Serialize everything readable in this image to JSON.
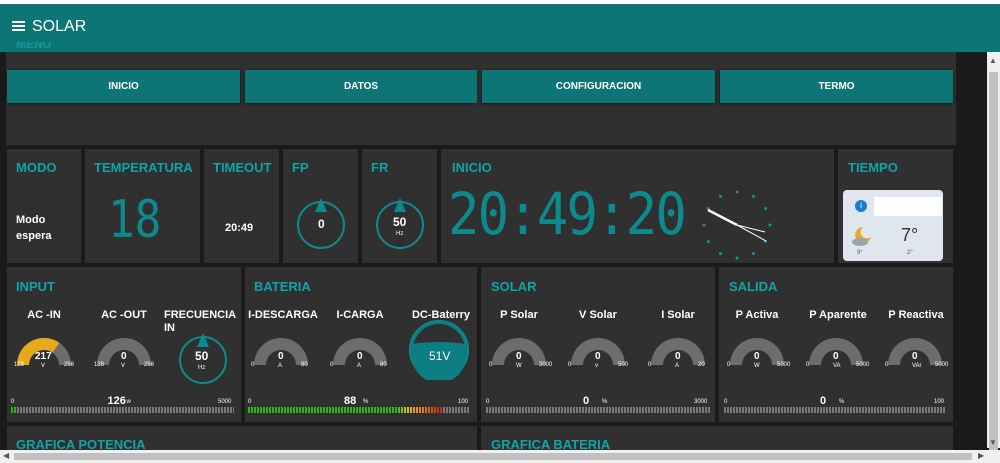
{
  "header": {
    "title": "SOLAR"
  },
  "menu": {
    "group_title": "MENU",
    "buttons": [
      "INICIO",
      "DATOS",
      "CONFIGURACION",
      "TERMO"
    ]
  },
  "modo": {
    "title": "MODO",
    "value_line1": "Modo",
    "value_line2": "espera"
  },
  "temperatura": {
    "title": "TEMPERATURA",
    "value": "18"
  },
  "timeout": {
    "title": "TIMEOUT",
    "value": "20:49"
  },
  "fp": {
    "title": "FP",
    "value": "0"
  },
  "fr": {
    "title": "FR",
    "value": "50",
    "unit": "Hz"
  },
  "inicio": {
    "title": "INICIO",
    "clock_digital": "20:49:20"
  },
  "tiempo": {
    "title": "TIEMPO",
    "temp": "7°",
    "min": "9°",
    "max": "2°"
  },
  "input": {
    "title": "INPUT",
    "ac_in": {
      "label": "AC -IN",
      "value": "217",
      "unit": "V",
      "min": "128",
      "max": "256",
      "fraction": 0.693
    },
    "ac_out": {
      "label": "AC -OUT",
      "value": "0",
      "unit": "V",
      "min": "128",
      "max": "256",
      "fraction": 0
    },
    "frecuencia": {
      "label": "FRECUENCIA IN",
      "value": "50",
      "unit": "Hz"
    },
    "bar": {
      "value": "126",
      "unit": "w",
      "min": "0",
      "max": "5000",
      "fraction": 0.025
    }
  },
  "bateria": {
    "title": "BATERIA",
    "descarga": {
      "label": "I-DESCARGA",
      "value": "0",
      "unit": "A",
      "min": "0",
      "max": "80",
      "fraction": 0
    },
    "carga": {
      "label": "I-CARGA",
      "value": "0",
      "unit": "A",
      "min": "0",
      "max": "80",
      "fraction": 0
    },
    "dc": {
      "label": "DC-Baterry",
      "value": "51V"
    },
    "bar": {
      "value": "88",
      "unit": "%",
      "min": "0",
      "max": "100",
      "fraction": 0.88
    }
  },
  "solar": {
    "title": "SOLAR",
    "p": {
      "label": "P Solar",
      "value": "0",
      "unit": "W",
      "min": "0",
      "max": "3000",
      "fraction": 0
    },
    "v": {
      "label": "V Solar",
      "value": "0",
      "unit": "v",
      "min": "0",
      "max": "500",
      "fraction": 0
    },
    "i": {
      "label": "I Solar",
      "value": "0",
      "unit": "A",
      "min": "0",
      "max": "20",
      "fraction": 0
    },
    "bar": {
      "value": "0",
      "unit": "%",
      "min": "0",
      "max": "3000",
      "fraction": 0
    }
  },
  "salida": {
    "title": "SALIDA",
    "activa": {
      "label": "P Activa",
      "value": "0",
      "unit": "W",
      "min": "0",
      "max": "5000",
      "fraction": 0
    },
    "aparente": {
      "label": "P Aparente",
      "value": "0",
      "unit": "VA",
      "min": "0",
      "max": "5000",
      "fraction": 0
    },
    "reactiva": {
      "label": "P Reactiva",
      "value": "0",
      "unit": "VAr",
      "min": "0",
      "max": "5000",
      "fraction": 0
    },
    "bar": {
      "value": "0",
      "unit": "%",
      "min": "0",
      "max": "100",
      "fraction": 0
    }
  },
  "graficas": {
    "potencia": "GRAFICA POTENCIA",
    "bateria": "GRAFICA BATERIA"
  },
  "colors": {
    "accent": "#0e7577",
    "title": "#0ea5a8",
    "gauge_fill": "#e6a91a",
    "card": "#303030",
    "bg": "#1a1a1a"
  }
}
